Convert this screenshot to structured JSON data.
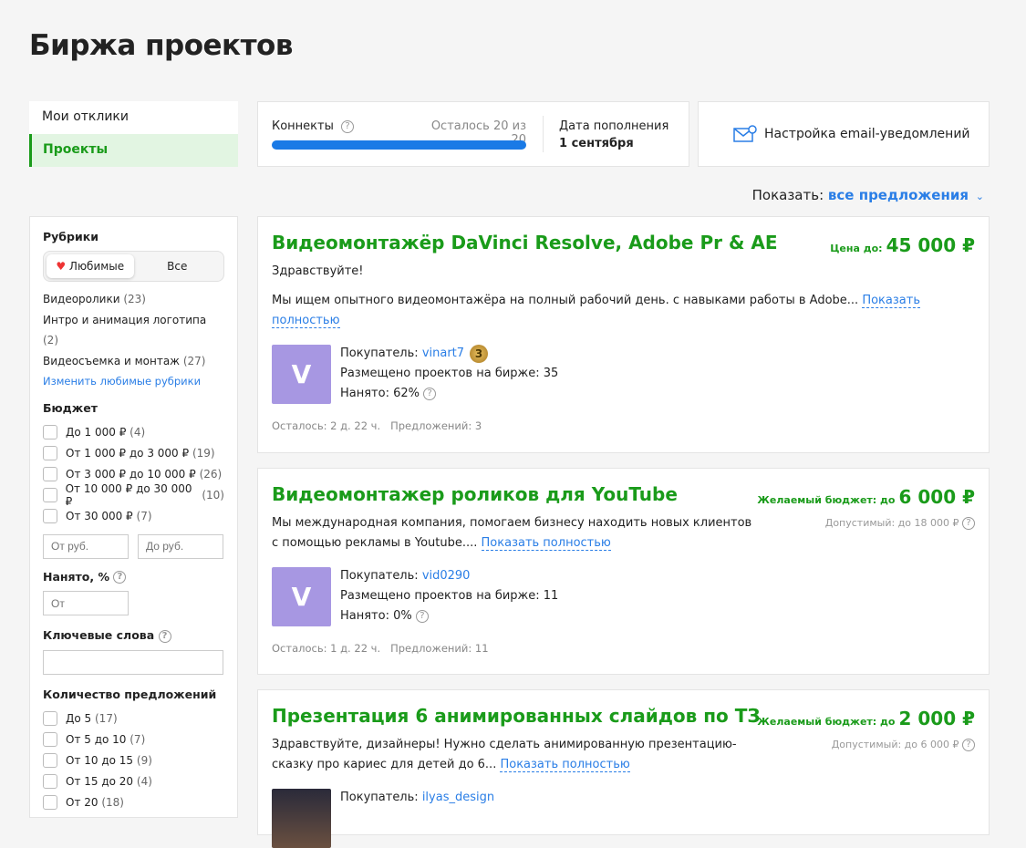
{
  "page_title": "Биржа проектов",
  "nav": {
    "items": [
      {
        "label": "Мои отклики"
      },
      {
        "label": "Проекты"
      }
    ]
  },
  "connects": {
    "label": "Коннекты",
    "remaining_label": "Осталось",
    "remaining": "20 из 20",
    "progress_percent": 100,
    "refill_label": "Дата пополнения",
    "refill_date": "1 сентября"
  },
  "email_settings": "Настройка email-уведомлений",
  "show": {
    "label": "Показать:",
    "value": "все предложения"
  },
  "sidebar": {
    "rubrics_title": "Рубрики",
    "seg_fav": "Любимые",
    "seg_all": "Все",
    "rubrics": [
      {
        "name": "Видеоролики",
        "count": "(23)"
      },
      {
        "name": "Интро и анимация логотипа",
        "count": "(2)"
      },
      {
        "name": "Видеосъемка и монтаж",
        "count": "(27)"
      }
    ],
    "edit_link": "Изменить любимые рубрики",
    "budget_title": "Бюджет",
    "budget": [
      {
        "name": "До 1 000 ₽",
        "count": "(4)"
      },
      {
        "name": "От 1 000 ₽ до 3 000 ₽",
        "count": "(19)"
      },
      {
        "name": "От 3 000 ₽ до 10 000 ₽",
        "count": "(26)"
      },
      {
        "name": "От 10 000 ₽ до 30 000 ₽",
        "count": "(10)"
      },
      {
        "name": "От 30 000 ₽",
        "count": "(7)"
      }
    ],
    "from_placeholder": "От руб.",
    "to_placeholder": "До руб.",
    "hired_title": "Нанято, %",
    "hired_placeholder": "От",
    "keywords_title": "Ключевые слова",
    "offers_title": "Количество предложений",
    "offers": [
      {
        "name": "До 5",
        "count": "(17)"
      },
      {
        "name": "От 5 до 10",
        "count": "(7)"
      },
      {
        "name": "От 10 до 15",
        "count": "(9)"
      },
      {
        "name": "От 15 до 20",
        "count": "(4)"
      },
      {
        "name": "От 20",
        "count": "(18)"
      }
    ]
  },
  "projects": [
    {
      "title": "Видеомонтажёр DaVinci Resolve, Adobe Pr & AE",
      "price_label": "Цена до:",
      "price": "45 000 ₽",
      "greeting": "Здравствуйте!",
      "desc": "Мы ищем опытного видеомонтажёра на полный рабочий день. с навыками работы в Adobe...",
      "more1": "Показать",
      "more2": "полностью",
      "avatar": "V",
      "buyer_label": "Покупатель:",
      "buyer": "vinart7",
      "badge": "3",
      "posted": "Размещено проектов на бирже: 35",
      "hired": "Нанято: 62%",
      "left": "Осталось: 2 д. 22 ч.",
      "offers": "Предложений: 3"
    },
    {
      "title": "Видеомонтажер роликов для YouTube",
      "price_label": "Желаемый бюджет: до",
      "price": "6 000 ₽",
      "allowed": "Допустимый: до 18 000 ₽",
      "desc1": "Мы международная компания, помогаем бизнесу находить новых клиентов",
      "desc2": "с помощью рекламы в Youtube....",
      "more": "Показать полностью",
      "avatar": "V",
      "buyer_label": "Покупатель:",
      "buyer": "vid0290",
      "posted": "Размещено проектов на бирже: 11",
      "hired": "Нанято: 0%",
      "left": "Осталось: 1 д. 22 ч.",
      "offers": "Предложений: 11"
    },
    {
      "title": "Презентация 6 анимированных слайдов по ТЗ",
      "price_label": "Желаемый бюджет: до",
      "price": "2 000 ₽",
      "allowed": "Допустимый: до 6 000 ₽",
      "desc1": "Здравствуйте, дизайнеры! Нужно сделать анимированную презентацию-",
      "desc2": "сказку про кариес для детей до 6...",
      "more": "Показать полностью",
      "buyer_label": "Покупатель:",
      "buyer": "ilyas_design"
    }
  ]
}
